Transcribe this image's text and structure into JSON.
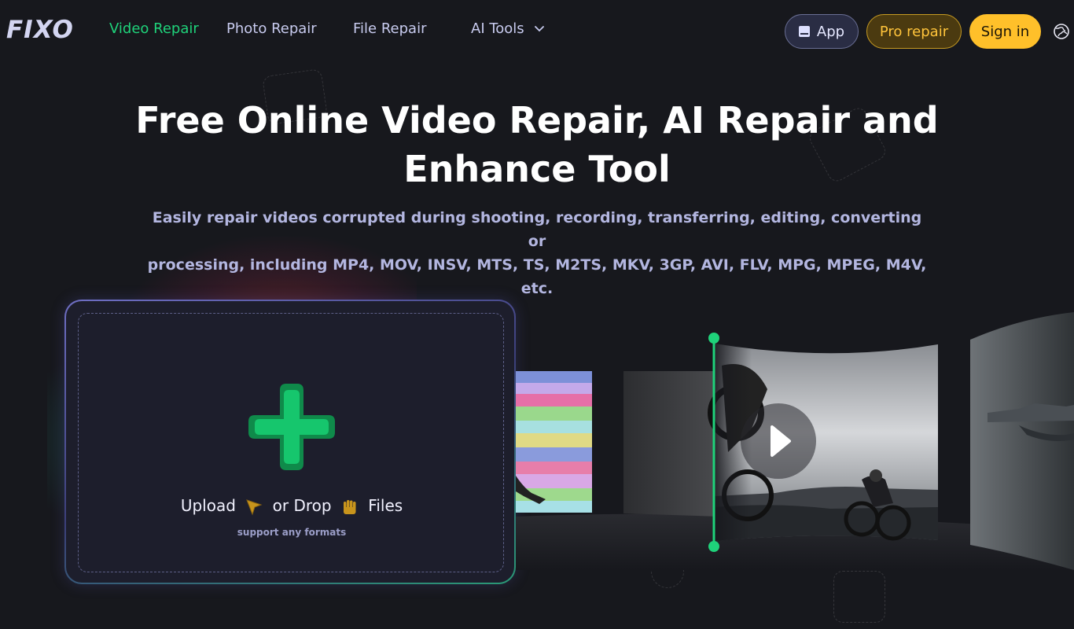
{
  "nav": {
    "logo": "FIXO",
    "links": [
      {
        "label": "Video Repair",
        "active": true
      },
      {
        "label": "Photo Repair",
        "active": false
      },
      {
        "label": "File Repair",
        "active": false
      },
      {
        "label": "AI Tools",
        "active": false,
        "dropdown": true
      }
    ],
    "buttons": {
      "app": "App",
      "pro_repair": "Pro repair",
      "sign_in": "Sign in"
    },
    "icons": [
      "app-icon",
      "chevron-down-icon",
      "globe-icon"
    ]
  },
  "hero": {
    "title_line1": "Free Online Video Repair, AI Repair and",
    "title_line2": "Enhance Tool",
    "subtitle_line1": "Easily repair videos corrupted during shooting, recording, transferring, editing, converting or",
    "subtitle_line2": "processing, including MP4, MOV, INSV, MTS, TS, M2TS, MKV, 3GP, AVI, FLV, MPG, MPEG, M4V, etc."
  },
  "upload": {
    "upload_text": "Upload",
    "or_drop_text": "or Drop",
    "files_text": "Files",
    "support_text": "support any formats",
    "icons": [
      "plus-icon",
      "cursor-icon",
      "hand-icon"
    ]
  },
  "demo": {
    "icons": [
      "play-icon",
      "compare-slider"
    ]
  },
  "colors": {
    "background": "#17181d",
    "accent_green": "#1fd27a",
    "pro_gold": "#ffc43b",
    "sign_in_yellow": "#ffc02a",
    "nav_text": "#c8cbef",
    "subtitle": "#b3b6e0"
  }
}
